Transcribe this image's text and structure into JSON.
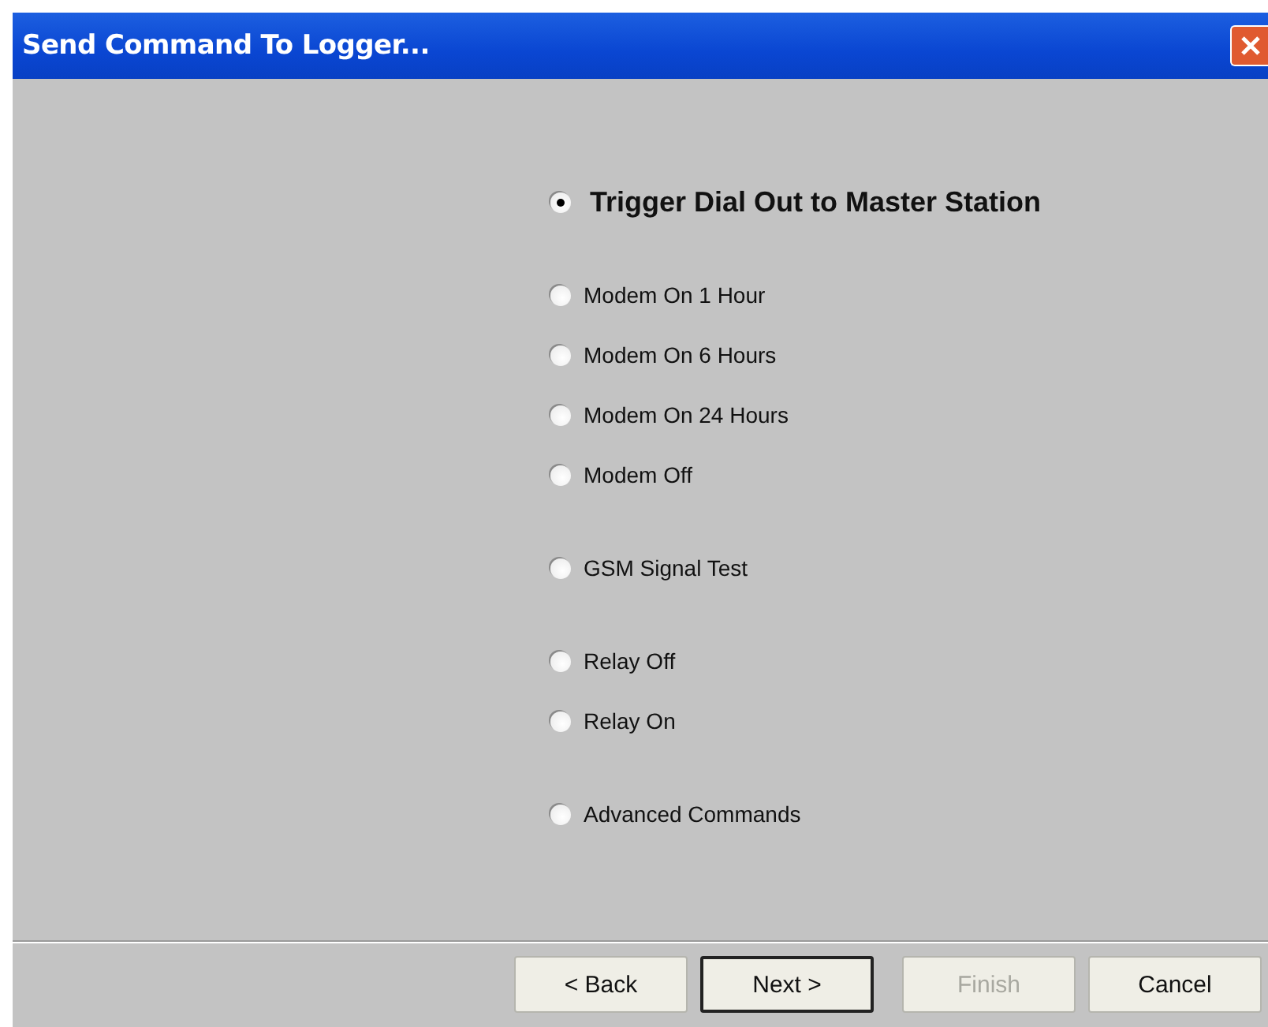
{
  "window": {
    "title": "Send Command To Logger..."
  },
  "option_groups": [
    {
      "options": [
        {
          "label": "Trigger Dial Out to Master Station",
          "kind": "large",
          "selected": true
        }
      ]
    },
    {
      "options": [
        {
          "label": "Modem On 1 Hour",
          "kind": "normal",
          "selected": false
        },
        {
          "label": "Modem On 6 Hours",
          "kind": "normal",
          "selected": false
        },
        {
          "label": "Modem On 24 Hours",
          "kind": "normal",
          "selected": false
        },
        {
          "label": "Modem Off",
          "kind": "normal",
          "selected": false
        }
      ]
    },
    {
      "options": [
        {
          "label": "GSM Signal Test",
          "kind": "normal",
          "selected": false
        }
      ]
    },
    {
      "options": [
        {
          "label": "Relay Off",
          "kind": "normal",
          "selected": false
        },
        {
          "label": "Relay On",
          "kind": "normal",
          "selected": false
        }
      ]
    },
    {
      "options": [
        {
          "label": "Advanced Commands",
          "kind": "normal",
          "selected": false
        }
      ]
    }
  ],
  "buttons": [
    {
      "label": "< Back",
      "disabled": false,
      "default": false
    },
    {
      "label": "Next >",
      "disabled": false,
      "default": true
    },
    {
      "label": "Finish",
      "disabled": true,
      "default": false
    },
    {
      "label": "Cancel",
      "disabled": false,
      "default": false
    }
  ]
}
